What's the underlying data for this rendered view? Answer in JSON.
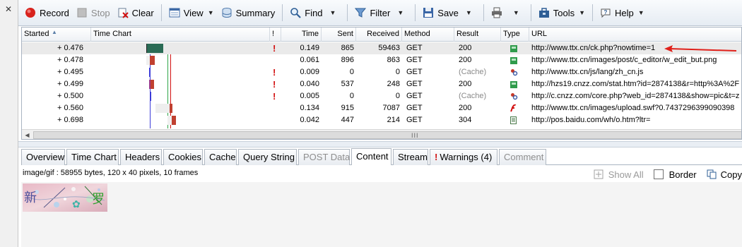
{
  "toolbar": {
    "record_label": "Record",
    "stop_label": "Stop",
    "clear_label": "Clear",
    "view_label": "View",
    "summary_label": "Summary",
    "find_label": "Find",
    "filter_label": "Filter",
    "save_label": "Save",
    "tools_label": "Tools",
    "help_label": "Help"
  },
  "grid": {
    "columns": [
      "Started",
      "Time Chart",
      "!",
      "Time",
      "Sent",
      "Received",
      "Method",
      "Result",
      "Type",
      "URL"
    ],
    "rows": [
      {
        "started": "+ 0.476",
        "warn": "!",
        "time": "0.149",
        "sent": "865",
        "received": "59463",
        "method": "GET",
        "result": "200",
        "type": "image-icon",
        "url": "http://www.ttx.cn/ck.php?nowtime=1"
      },
      {
        "started": "+ 0.478",
        "warn": "",
        "time": "0.061",
        "sent": "896",
        "received": "863",
        "method": "GET",
        "result": "200",
        "type": "image-icon",
        "url": "http://www.ttx.cn/images/post/c_editor/w_edit_but.png"
      },
      {
        "started": "+ 0.495",
        "warn": "!",
        "time": "0.009",
        "sent": "0",
        "received": "0",
        "method": "GET",
        "result": "(Cache)",
        "type": "script-icon",
        "url": "http://www.ttx.cn/js/lang/zh_cn.js"
      },
      {
        "started": "+ 0.499",
        "warn": "!",
        "time": "0.040",
        "sent": "537",
        "received": "248",
        "method": "GET",
        "result": "200",
        "type": "image-icon",
        "url": "http://hzs19.cnzz.com/stat.htm?id=2874138&r=http%3A%2F"
      },
      {
        "started": "+ 0.500",
        "warn": "!",
        "time": "0.005",
        "sent": "0",
        "received": "0",
        "method": "GET",
        "result": "(Cache)",
        "type": "script-icon",
        "url": "http://c.cnzz.com/core.php?web_id=2874138&show=pic&t=z"
      },
      {
        "started": "+ 0.560",
        "warn": "",
        "time": "0.134",
        "sent": "915",
        "received": "7087",
        "method": "GET",
        "result": "200",
        "type": "flash-icon",
        "url": "http://www.ttx.cn/images/upload.swf?0.7437296399090398"
      },
      {
        "started": "+ 0.698",
        "warn": "",
        "time": "0.042",
        "sent": "447",
        "received": "214",
        "method": "GET",
        "result": "304",
        "type": "document-icon",
        "url": "http://pos.baidu.com/wh/o.htm?ltr="
      }
    ]
  },
  "tabs": [
    "Overview",
    "Time Chart",
    "Headers",
    "Cookies",
    "Cache",
    "Query String",
    "POST Data",
    "Content",
    "Stream",
    "Warnings (4)",
    "Comment"
  ],
  "content": {
    "info": "image/gif : 58955 bytes, 120 x 40 pixels, 10 frames",
    "show_all_label": "Show All",
    "border_label": "Border",
    "copy_label": "Copy",
    "gif_chars": [
      "新",
      "罗"
    ]
  },
  "colors": {
    "accent_red": "#d21010",
    "selection": "#eaeaea",
    "grid_border": "#a9b4c2"
  }
}
